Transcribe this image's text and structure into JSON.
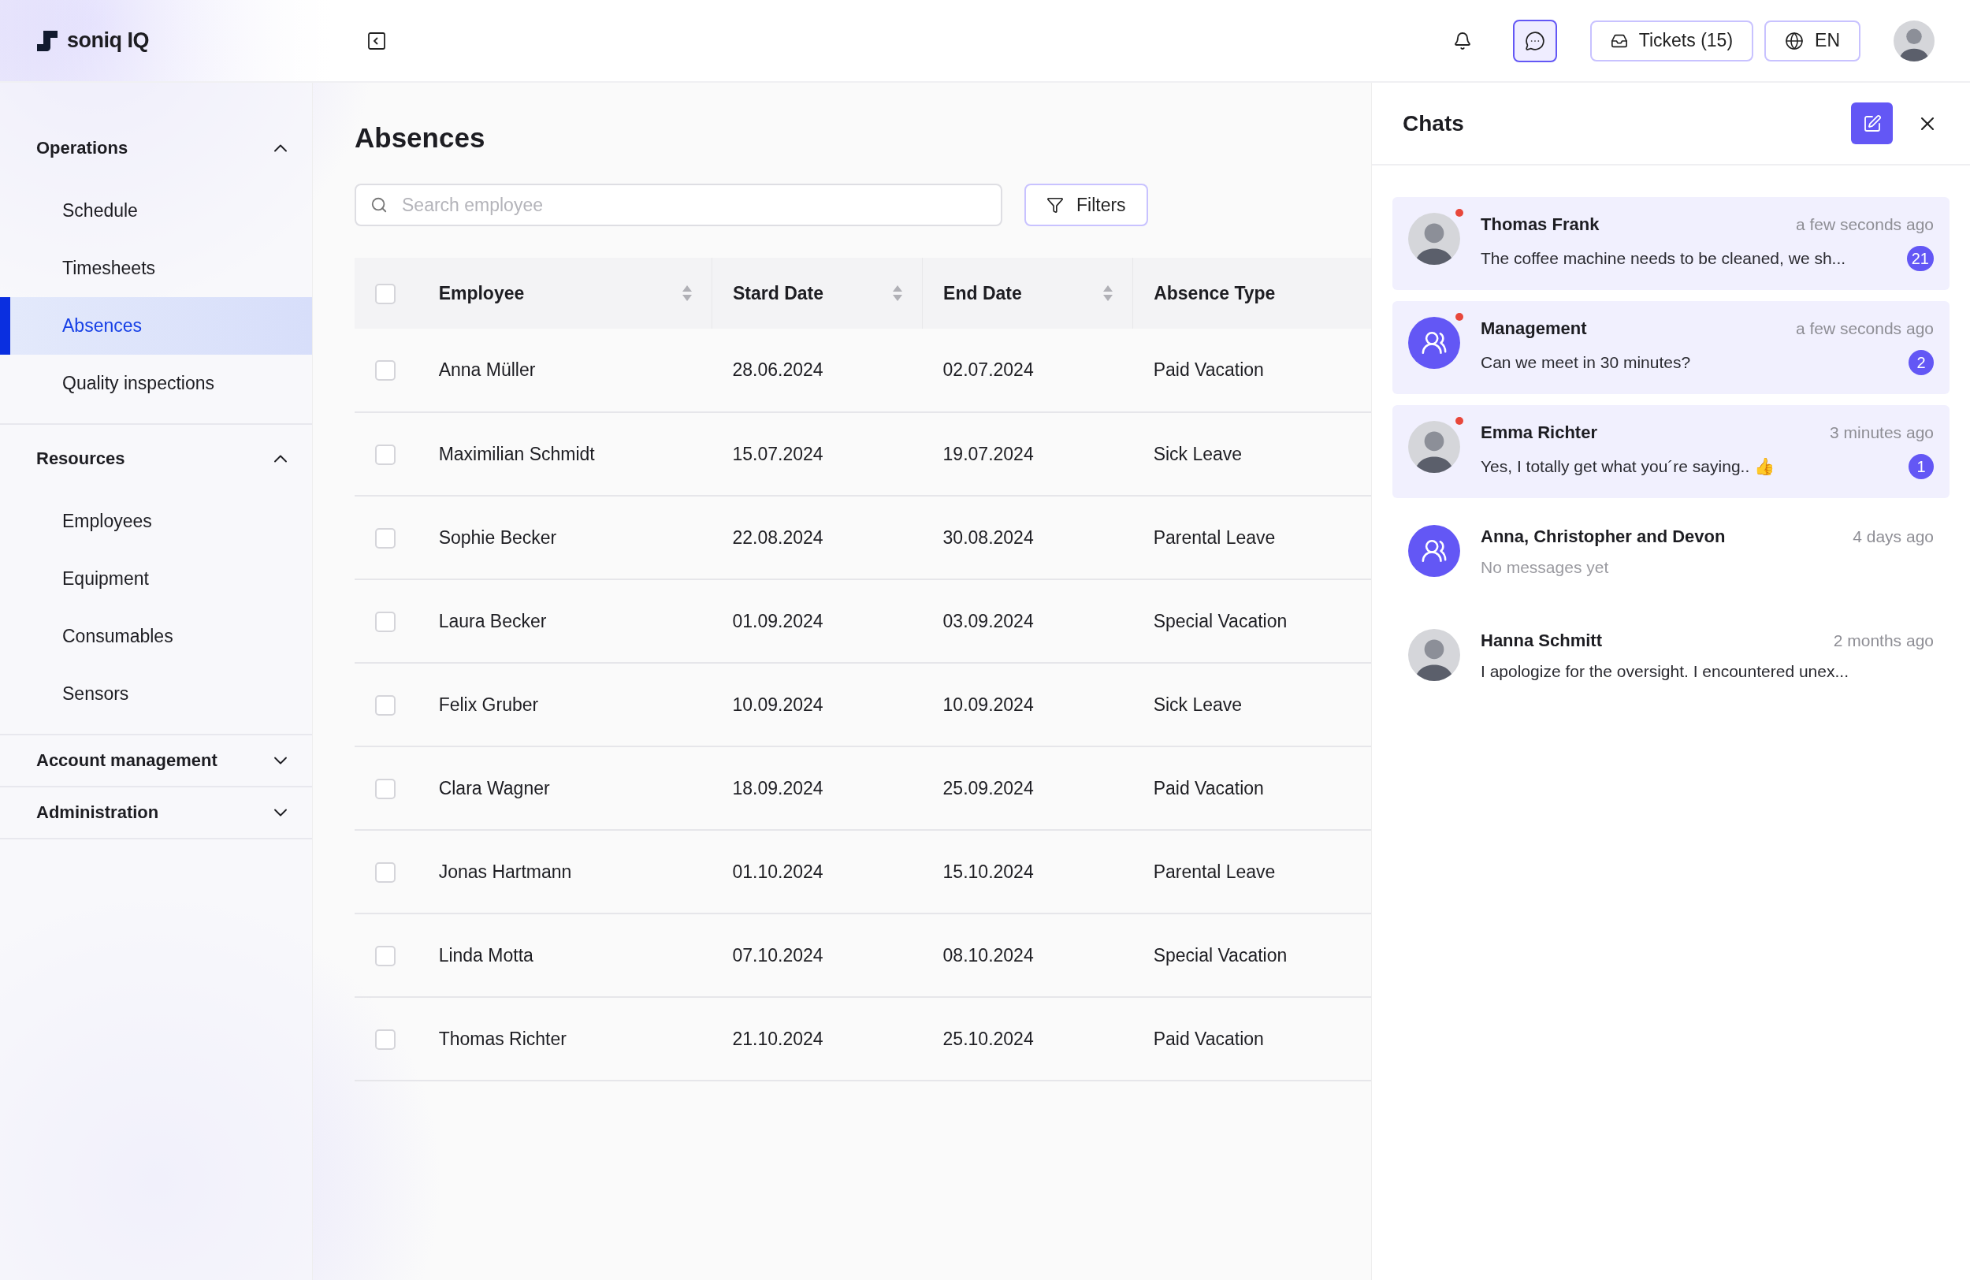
{
  "brand": {
    "name": "soniq IQ"
  },
  "topbar": {
    "chat_active": true,
    "tickets": "Tickets (15)",
    "language": "EN"
  },
  "sidebar": {
    "groups": [
      {
        "label": "Operations",
        "expanded": true,
        "items": [
          {
            "label": "Schedule",
            "selected": false
          },
          {
            "label": "Timesheets",
            "selected": false
          },
          {
            "label": "Absences",
            "selected": true
          },
          {
            "label": "Quality inspections",
            "selected": false
          }
        ]
      },
      {
        "label": "Resources",
        "expanded": true,
        "items": [
          {
            "label": "Employees",
            "selected": false
          },
          {
            "label": "Equipment",
            "selected": false
          },
          {
            "label": "Consumables",
            "selected": false
          },
          {
            "label": "Sensors",
            "selected": false
          }
        ]
      },
      {
        "label": "Account management",
        "expanded": false
      },
      {
        "label": "Administration",
        "expanded": false
      }
    ]
  },
  "page": {
    "title": "Absences",
    "search": {
      "placeholder": "Search employee"
    },
    "filters_button": "Filters"
  },
  "table": {
    "header_checked": false,
    "columns": [
      {
        "label": "Employee",
        "sortable": true
      },
      {
        "label": "Stard Date",
        "sortable": true
      },
      {
        "label": "End Date",
        "sortable": true
      },
      {
        "label": "Absence Type",
        "sortable": false
      }
    ],
    "rows": [
      {
        "checked": false,
        "cells": [
          "Anna Müller",
          "28.06.2024",
          "02.07.2024",
          "Paid Vacation"
        ]
      },
      {
        "checked": false,
        "cells": [
          "Maximilian Schmidt",
          "15.07.2024",
          "19.07.2024",
          "Sick Leave"
        ]
      },
      {
        "checked": false,
        "cells": [
          "Sophie Becker",
          "22.08.2024",
          "30.08.2024",
          "Parental Leave"
        ]
      },
      {
        "checked": false,
        "cells": [
          "Laura Becker",
          "01.09.2024",
          "03.09.2024",
          "Special Vacation"
        ]
      },
      {
        "checked": false,
        "cells": [
          "Felix Gruber",
          "10.09.2024",
          "10.09.2024",
          "Sick Leave"
        ]
      },
      {
        "checked": false,
        "cells": [
          "Clara Wagner",
          "18.09.2024",
          "25.09.2024",
          "Paid Vacation"
        ]
      },
      {
        "checked": false,
        "cells": [
          "Jonas Hartmann",
          "01.10.2024",
          "15.10.2024",
          "Parental Leave"
        ]
      },
      {
        "checked": false,
        "cells": [
          "Linda Motta",
          "07.10.2024",
          "08.10.2024",
          "Special Vacation"
        ]
      },
      {
        "checked": false,
        "cells": [
          "Thomas Richter",
          "21.10.2024",
          "25.10.2024",
          "Paid Vacation"
        ]
      }
    ]
  },
  "chats": {
    "title": "Chats",
    "items": [
      {
        "name": "Thomas Frank",
        "kind": "photo",
        "time": "a few seconds ago",
        "message": "The coffee machine needs to be cleaned, we sh...",
        "unread": true,
        "count": "21",
        "muted_message": false
      },
      {
        "name": "Management",
        "kind": "group",
        "time": "a few seconds ago",
        "message": "Can we meet in 30 minutes?",
        "unread": true,
        "count": "2",
        "muted_message": false
      },
      {
        "name": "Emma Richter",
        "kind": "photo",
        "time": "3 minutes ago",
        "message": "Yes, I totally get what you´re saying.. 👍",
        "unread": true,
        "count": "1",
        "muted_message": false
      },
      {
        "name": "Anna, Christopher and Devon",
        "kind": "group",
        "time": "4 days ago",
        "message": "No messages yet",
        "unread": false,
        "muted_message": true
      },
      {
        "name": "Hanna Schmitt",
        "kind": "photo",
        "time": "2 months ago",
        "message": "I apologize for the oversight. I encountered unex...",
        "unread": false,
        "muted_message": false
      }
    ]
  }
}
